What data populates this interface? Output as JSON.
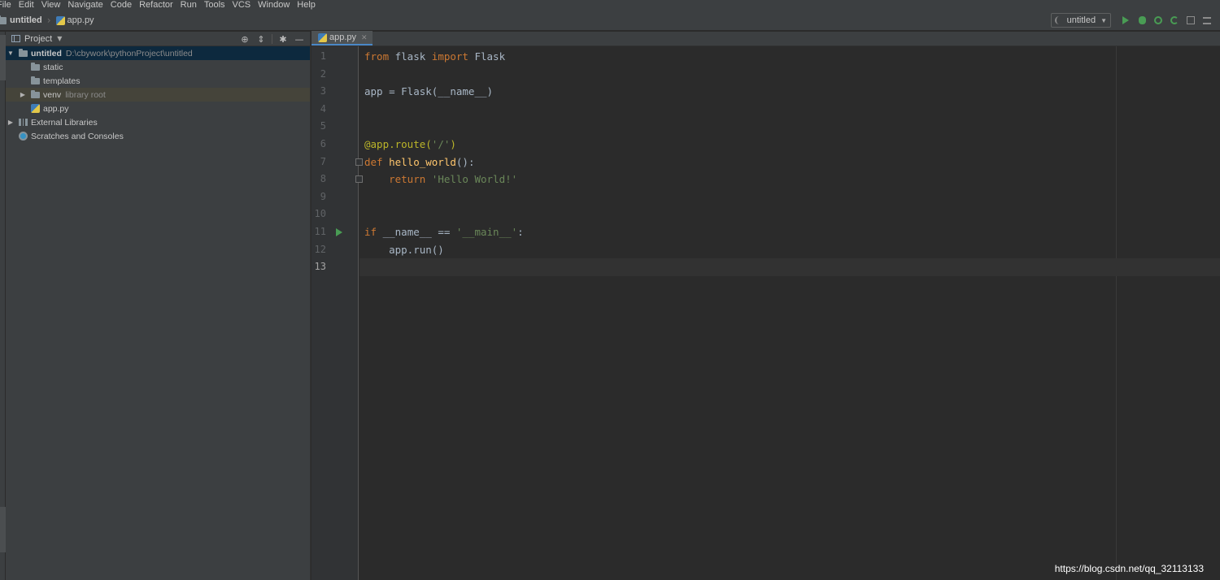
{
  "menu": [
    "File",
    "Edit",
    "View",
    "Navigate",
    "Code",
    "Refactor",
    "Run",
    "Tools",
    "VCS",
    "Window",
    "Help"
  ],
  "navbar": {
    "project": "untitled",
    "file": "app.py",
    "run_config": "untitled"
  },
  "project_panel": {
    "title": "Project",
    "tree": [
      {
        "name": "untitled",
        "path": "D:\\cbywork\\pythonProject\\untitled"
      },
      {
        "name": "static"
      },
      {
        "name": "templates"
      },
      {
        "name": "venv",
        "note": "library root"
      },
      {
        "name": "app.py"
      },
      {
        "name": "External Libraries"
      },
      {
        "name": "Scratches and Consoles"
      }
    ]
  },
  "editor": {
    "tab": "app.py",
    "lines": [
      "1",
      "2",
      "3",
      "4",
      "5",
      "6",
      "7",
      "8",
      "9",
      "10",
      "11",
      "12",
      "13"
    ],
    "code": {
      "l1_from": "from",
      "l1_mod": " flask ",
      "l1_import": "import",
      "l1_cls": " Flask",
      "l3": "app = Flask(__name__)",
      "l6_dec": "@app.route(",
      "l6_str": "'/'",
      "l6_end": ")",
      "l7_def": "def",
      "l7_fn": " hello_world",
      "l7_end": "():",
      "l8_indent": "    ",
      "l8_ret": "return",
      "l8_str": " 'Hello World!'",
      "l11_if": "if",
      "l11_mid": " __name__ == ",
      "l11_str": "'__main__'",
      "l11_end": ":",
      "l12": "    app.run()"
    }
  },
  "watermark": "https://blog.csdn.net/qq_32113133",
  "colors": {
    "keyword": "#cc7832",
    "decorator": "#bbb529",
    "function": "#ffc66d",
    "string": "#6a8759",
    "text": "#a9b7c6",
    "selection": "#0d293e",
    "accent": "#4a88c7",
    "run_green": "#499c54"
  }
}
